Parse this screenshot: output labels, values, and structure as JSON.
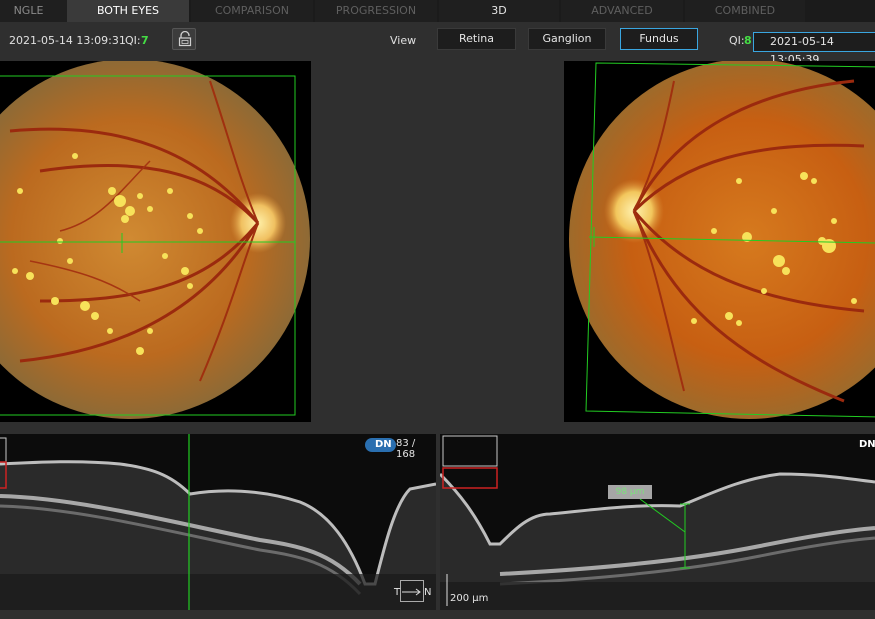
{
  "tabs": [
    {
      "label": "NGLE",
      "state": "normal"
    },
    {
      "label": "BOTH EYES",
      "state": "active"
    },
    {
      "label": "COMPARISON",
      "state": "disabled"
    },
    {
      "label": "PROGRESSION",
      "state": "disabled"
    },
    {
      "label": "3D",
      "state": "enabled"
    },
    {
      "label": "ADVANCED",
      "state": "disabled"
    },
    {
      "label": "COMBINED",
      "state": "disabled"
    }
  ],
  "toolbar": {
    "left_timestamp": "2021-05-14 13:09:31",
    "left_qi_label": "QI:",
    "left_qi_value": "7",
    "view_label": "View",
    "view_buttons": [
      "Retina",
      "Ganglion",
      "Fundus"
    ],
    "selected_view": "Fundus",
    "right_qi_label": "QI:",
    "right_qi_value": "8",
    "right_timestamp": "2021-05-14 13:05:39"
  },
  "oct_left": {
    "badge": "DN",
    "slice_count": "83 / 168",
    "orientation_left": "T",
    "orientation_right": "N"
  },
  "oct_right": {
    "badge": "DN",
    "scale_bar": "200 µm",
    "measurement_label": "98 µm"
  },
  "colors": {
    "accent_blue": "#3aa6e0",
    "qi_green": "#44dd44",
    "scan_green": "#22cc22",
    "marker_red": "#cc2222"
  },
  "icons": {
    "lock": "lock-icon"
  }
}
